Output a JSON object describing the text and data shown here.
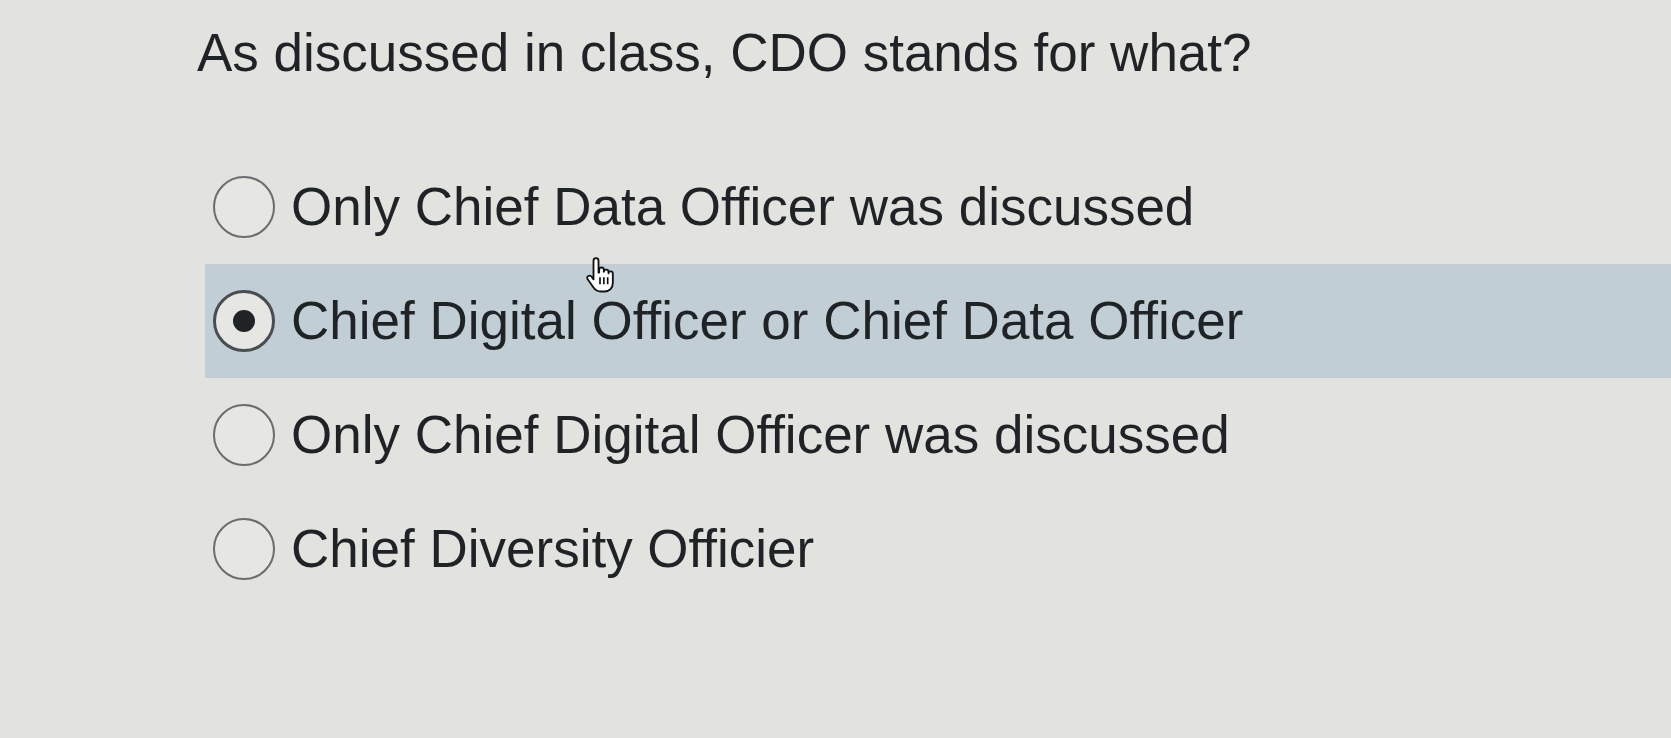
{
  "question": "As discussed in class, CDO stands for what?",
  "options": [
    {
      "label": "Only Chief Data Officer was discussed",
      "selected": false
    },
    {
      "label": "Chief Digital Officer or Chief Data Officer",
      "selected": true
    },
    {
      "label": "Only Chief Digital Officer was discussed",
      "selected": false
    },
    {
      "label": "Chief Diversity Officier",
      "selected": false
    }
  ]
}
